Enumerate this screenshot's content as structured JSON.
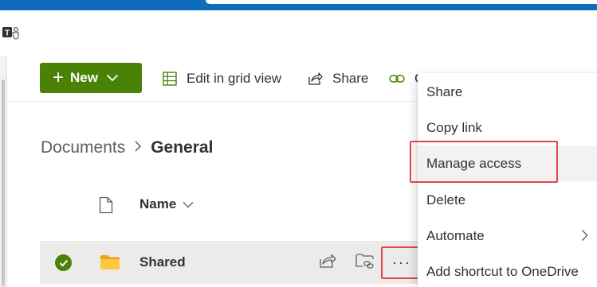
{
  "colors": {
    "accent_blue": "#0f6cbd",
    "new_green": "#498205",
    "highlight_red": "#e5434a",
    "row_selected": "#edebe9"
  },
  "toolbar": {
    "new_label": "New",
    "grid_label": "Edit in grid view",
    "share_label": "Share",
    "copy_label": "C"
  },
  "breadcrumb": {
    "root": "Documents",
    "current": "General"
  },
  "list": {
    "column_name": "Name",
    "rows": [
      {
        "name": "Shared",
        "selected": true
      }
    ],
    "more_label": "···"
  },
  "context_menu": {
    "items": [
      {
        "label": "Share"
      },
      {
        "label": "Copy link"
      },
      {
        "label": "Manage access",
        "highlighted": true
      },
      {
        "label": "Delete"
      },
      {
        "label": "Automate",
        "has_submenu": true
      },
      {
        "label": "Add shortcut to OneDrive"
      }
    ]
  }
}
